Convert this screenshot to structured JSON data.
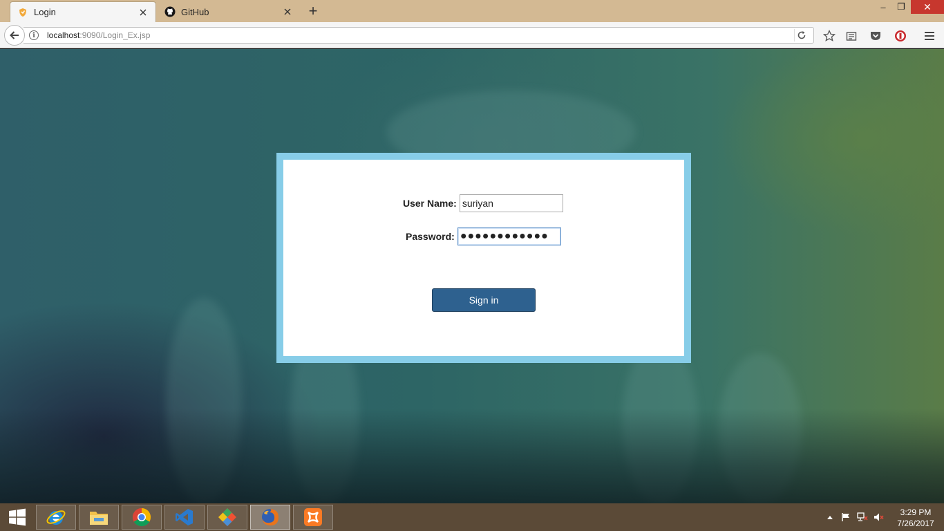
{
  "browser": {
    "tabs": [
      {
        "title": "Login",
        "active": true,
        "icon": "shield-favicon-icon"
      },
      {
        "title": "GitHub",
        "active": false,
        "icon": "github-icon"
      }
    ],
    "new_tab_label": "+",
    "window_controls": {
      "minimize": "–",
      "maximize": "❐",
      "close": "✕"
    },
    "url": {
      "host": "localhost",
      "rest": ":9090/Login_Ex.jsp"
    },
    "toolbar_icons": [
      "star-icon",
      "reading-list-icon",
      "pocket-icon",
      "adblock-icon",
      "menu-icon"
    ]
  },
  "login": {
    "username_label": "User Name:",
    "username_value": "suriyan",
    "password_label": "Password:",
    "password_masked": "●●●●●●●●●●●●",
    "signin_label": "Sign in"
  },
  "taskbar": {
    "apps": [
      "internet-explorer-icon",
      "file-explorer-icon",
      "chrome-icon",
      "visual-studio-icon",
      "git-icon",
      "firefox-icon",
      "xampp-icon"
    ],
    "active_app": "firefox-icon",
    "clock_time": "3:29 PM",
    "clock_date": "7/26/2017"
  },
  "colors": {
    "titlebar": "#d3b993",
    "frame_border": "#87cde8",
    "signin_button": "#2e618f",
    "taskbar": "#5b4a37"
  }
}
